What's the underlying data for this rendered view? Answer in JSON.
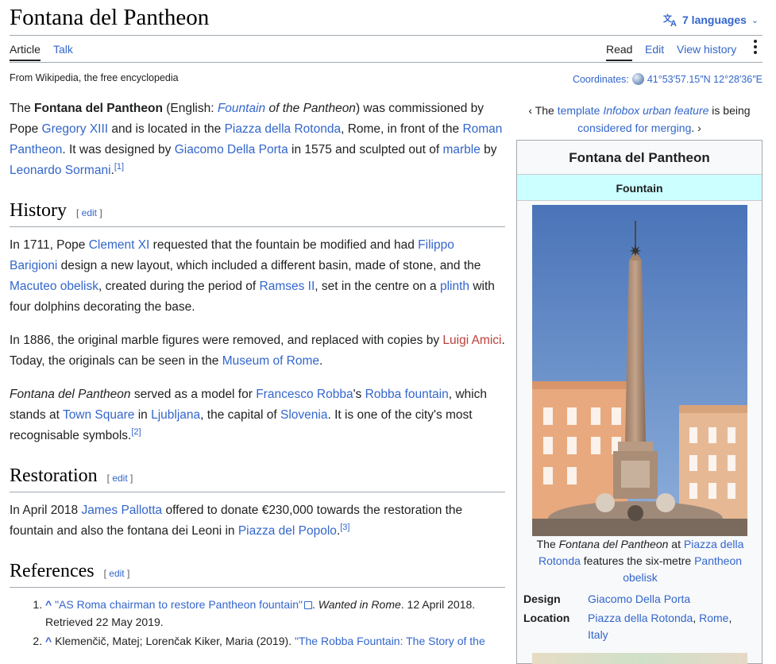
{
  "page": {
    "title": "Fontana del Pantheon",
    "languages_label": "7 languages",
    "tabs_left": [
      "Article",
      "Talk"
    ],
    "tabs_right": [
      "Read",
      "Edit",
      "View history"
    ],
    "tagline": "From Wikipedia, the free encyclopedia",
    "coordinates_label": "Coordinates:",
    "coordinates_value": "41°53′57.15″N 12°28′36″E"
  },
  "intro": {
    "t1": "The ",
    "b1": "Fontana del Pantheon",
    "t2": " (English: ",
    "l1": "Fountain",
    "i1": " of the Pantheon",
    "t3": ") was commissioned by Pope ",
    "l2": "Gregory XIII",
    "t4": " and is located in the ",
    "l3": "Piazza della Rotonda",
    "t5": ", Rome, in front of the ",
    "l4": "Roman Pantheon",
    "t6": ". It was designed by ",
    "l5": "Giacomo Della Porta",
    "t7": " in 1575 and sculpted out of ",
    "l6": "marble",
    "t8": " by ",
    "l7": "Leonardo Sormani",
    "t9": ".",
    "ref": "[1]"
  },
  "edit_label": "edit",
  "history": {
    "heading": "History",
    "p1": {
      "t1": "In 1711, Pope ",
      "l1": "Clement XI",
      "t2": " requested that the fountain be modified and had ",
      "l2": "Filippo Barigioni",
      "t3": " design a new layout, which included a different basin, made of stone, and the ",
      "l3": "Macuteo obelisk",
      "t4": ", created during the period of ",
      "l4": "Ramses II",
      "t5": ", set in the centre on a ",
      "l5": "plinth",
      "t6": " with four dolphins decorating the base."
    },
    "p2": {
      "t1": "In 1886, the original marble figures were removed, and replaced with copies by ",
      "r1": "Luigi Amici",
      "t2": ". Today, the originals can be seen in the ",
      "l1": "Museum of Rome",
      "t3": "."
    },
    "p3": {
      "i1": "Fontana del Pantheon",
      "t1": " served as a model for ",
      "l1": "Francesco Robba",
      "t2": "'s ",
      "l2": "Robba fountain",
      "t3": ", which stands at ",
      "l3": "Town Square",
      "t4": " in ",
      "l4": "Ljubljana",
      "t5": ", the capital of ",
      "l5": "Slovenia",
      "t6": ". It is one of the city's most recognisable symbols.",
      "ref": "[2]"
    }
  },
  "restoration": {
    "heading": "Restoration",
    "p1": {
      "t1": "In April 2018 ",
      "l1": "James Pallotta",
      "t2": " offered to donate €230,000 towards the restoration the fountain and also the fontana dei Leoni in ",
      "l2": "Piazza del Popolo",
      "t3": ".",
      "ref": "[3]"
    }
  },
  "references": {
    "heading": "References",
    "r1": {
      "caret": "^",
      "link": "\"AS Roma chairman to restore Pantheon fountain\"",
      "t1": ". ",
      "i1": "Wanted in Rome",
      "t2": ". 12 April 2018. Retrieved 22 May 2019."
    },
    "r2": {
      "caret": "^",
      "t1": " Klemenčič, Matej; Lorenčak Kiker, Maria (2019). ",
      "link": "\"The Robba Fountain: The Story of the"
    }
  },
  "notice": {
    "t1": "‹ The ",
    "l1": "template",
    "t2": " ",
    "i1": "Infobox urban feature",
    "t3": " is being ",
    "l2": "considered for merging",
    "t4": ". ›"
  },
  "infobox": {
    "title": "Fontana del Pantheon",
    "type": "Fountain",
    "caption": {
      "t1": "The ",
      "i1": "Fontana del Pantheon",
      "t2": " at ",
      "l1": "Piazza della Rotonda",
      "t3": " features the six-metre ",
      "l2": "Pantheon obelisk"
    },
    "design_label": "Design",
    "design_value": "Giacomo Della Porta",
    "location_label": "Location",
    "location_l1": "Piazza della Rotonda",
    "location_sep1": ", ",
    "location_l2": "Rome",
    "location_sep2": ", ",
    "location_l3": "Italy"
  },
  "colors": {
    "link": "#3366cc",
    "redlink": "#ba3f3a",
    "infobox_type_bg": "#ccffff"
  }
}
